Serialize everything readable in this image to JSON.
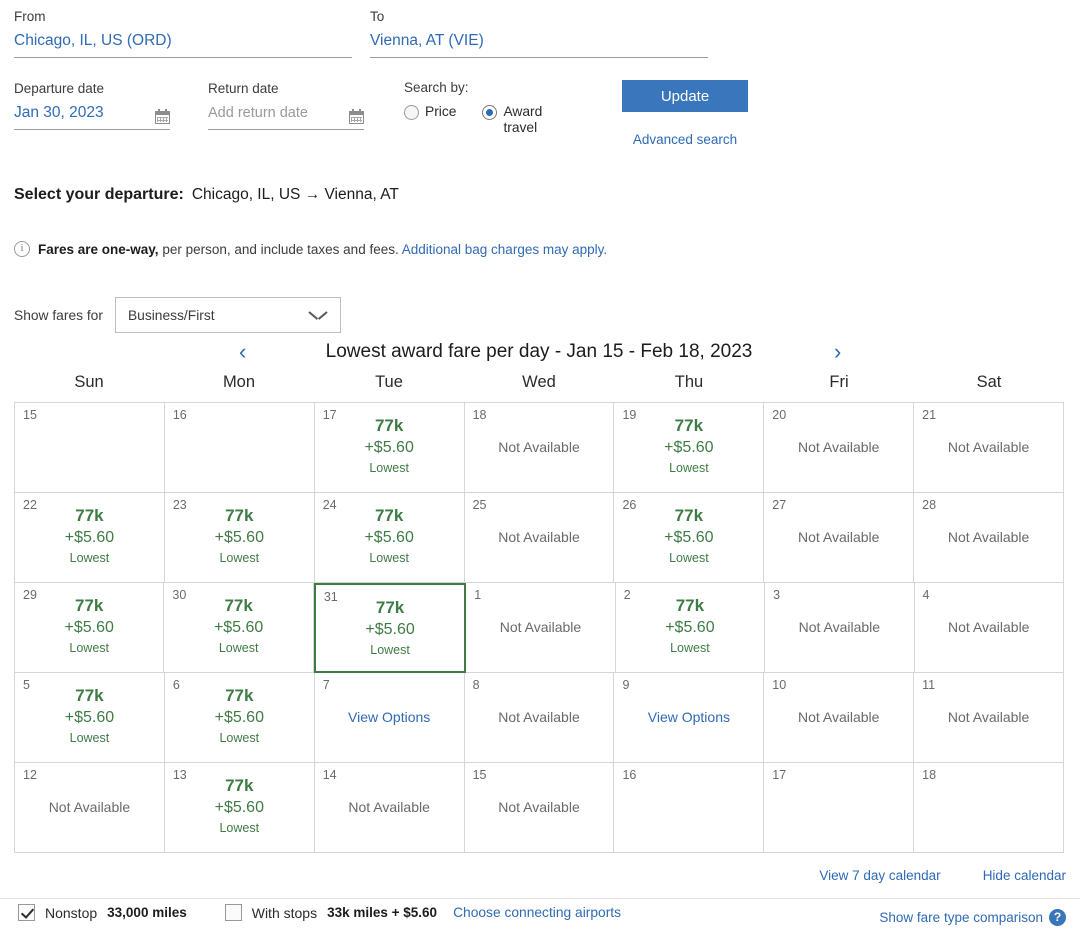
{
  "search": {
    "from_label": "From",
    "from_value": "Chicago, IL, US (ORD)",
    "to_label": "To",
    "to_value": "Vienna, AT (VIE)",
    "departure_label": "Departure date",
    "departure_value": "Jan 30, 2023",
    "return_label": "Return date",
    "return_placeholder": "Add return date",
    "search_by_label": "Search by:",
    "option_price": "Price",
    "option_award": "Award travel",
    "selected_search_by": "Award travel",
    "update_label": "Update",
    "advanced_search_label": "Advanced search",
    "accent_color": "#3a76bc"
  },
  "departure": {
    "heading": "Select your departure:",
    "route": "Chicago, IL, US → Vienna, AT"
  },
  "note": {
    "bold_part": "Fares are one-way,",
    "rest": " per person, and include taxes and fees. ",
    "link": "Additional bag charges may apply.",
    "icon": "info-icon"
  },
  "fare_filter": {
    "label": "Show fares for",
    "selected": "Business/First"
  },
  "calendar": {
    "title": "Lowest award fare per day - Jan 15 - Feb 18, 2023",
    "prev_arrow": "‹",
    "next_arrow": "›",
    "day_headers": [
      "Sun",
      "Mon",
      "Tue",
      "Wed",
      "Thu",
      "Fri",
      "Sat"
    ],
    "selected_day": "31",
    "available_color": "#3f7c45",
    "link_color": "#2f6ab5",
    "weeks": [
      [
        {
          "day": "15",
          "state": "empty"
        },
        {
          "day": "16",
          "state": "empty"
        },
        {
          "day": "17",
          "state": "fare",
          "miles": "77k",
          "tax": "+$5.60",
          "tag": "Lowest"
        },
        {
          "day": "18",
          "state": "unavailable",
          "text": "Not Available"
        },
        {
          "day": "19",
          "state": "fare",
          "miles": "77k",
          "tax": "+$5.60",
          "tag": "Lowest"
        },
        {
          "day": "20",
          "state": "unavailable",
          "text": "Not Available"
        },
        {
          "day": "21",
          "state": "unavailable",
          "text": "Not Available"
        }
      ],
      [
        {
          "day": "22",
          "state": "fare",
          "miles": "77k",
          "tax": "+$5.60",
          "tag": "Lowest"
        },
        {
          "day": "23",
          "state": "fare",
          "miles": "77k",
          "tax": "+$5.60",
          "tag": "Lowest"
        },
        {
          "day": "24",
          "state": "fare",
          "miles": "77k",
          "tax": "+$5.60",
          "tag": "Lowest"
        },
        {
          "day": "25",
          "state": "unavailable",
          "text": "Not Available"
        },
        {
          "day": "26",
          "state": "fare",
          "miles": "77k",
          "tax": "+$5.60",
          "tag": "Lowest"
        },
        {
          "day": "27",
          "state": "unavailable",
          "text": "Not Available"
        },
        {
          "day": "28",
          "state": "unavailable",
          "text": "Not Available"
        }
      ],
      [
        {
          "day": "29",
          "state": "fare",
          "miles": "77k",
          "tax": "+$5.60",
          "tag": "Lowest"
        },
        {
          "day": "30",
          "state": "fare",
          "miles": "77k",
          "tax": "+$5.60",
          "tag": "Lowest"
        },
        {
          "day": "31",
          "state": "fare",
          "miles": "77k",
          "tax": "+$5.60",
          "tag": "Lowest",
          "selected": true
        },
        {
          "day": "1",
          "state": "unavailable",
          "text": "Not Available"
        },
        {
          "day": "2",
          "state": "fare",
          "miles": "77k",
          "tax": "+$5.60",
          "tag": "Lowest"
        },
        {
          "day": "3",
          "state": "unavailable",
          "text": "Not Available"
        },
        {
          "day": "4",
          "state": "unavailable",
          "text": "Not Available"
        }
      ],
      [
        {
          "day": "5",
          "state": "fare",
          "miles": "77k",
          "tax": "+$5.60",
          "tag": "Lowest"
        },
        {
          "day": "6",
          "state": "fare",
          "miles": "77k",
          "tax": "+$5.60",
          "tag": "Lowest"
        },
        {
          "day": "7",
          "state": "options",
          "text": "View Options"
        },
        {
          "day": "8",
          "state": "unavailable",
          "text": "Not Available"
        },
        {
          "day": "9",
          "state": "options",
          "text": "View Options"
        },
        {
          "day": "10",
          "state": "unavailable",
          "text": "Not Available"
        },
        {
          "day": "11",
          "state": "unavailable",
          "text": "Not Available"
        }
      ],
      [
        {
          "day": "12",
          "state": "unavailable",
          "text": "Not Available"
        },
        {
          "day": "13",
          "state": "fare",
          "miles": "77k",
          "tax": "+$5.60",
          "tag": "Lowest"
        },
        {
          "day": "14",
          "state": "unavailable",
          "text": "Not Available"
        },
        {
          "day": "15",
          "state": "unavailable",
          "text": "Not Available"
        },
        {
          "day": "16",
          "state": "empty"
        },
        {
          "day": "17",
          "state": "empty"
        },
        {
          "day": "18",
          "state": "empty"
        }
      ]
    ],
    "view_7_day": "View 7 day calendar",
    "hide_calendar": "Hide calendar"
  },
  "footer": {
    "nonstop_label": "Nonstop",
    "nonstop_value": "33,000 miles",
    "nonstop_checked": true,
    "withstops_label": "With stops",
    "withstops_value": "33k miles + $5.60",
    "withstops_checked": false,
    "connecting_link": "Choose connecting airports",
    "comparison_link": "Show fare type comparison",
    "help_glyph": "?"
  }
}
